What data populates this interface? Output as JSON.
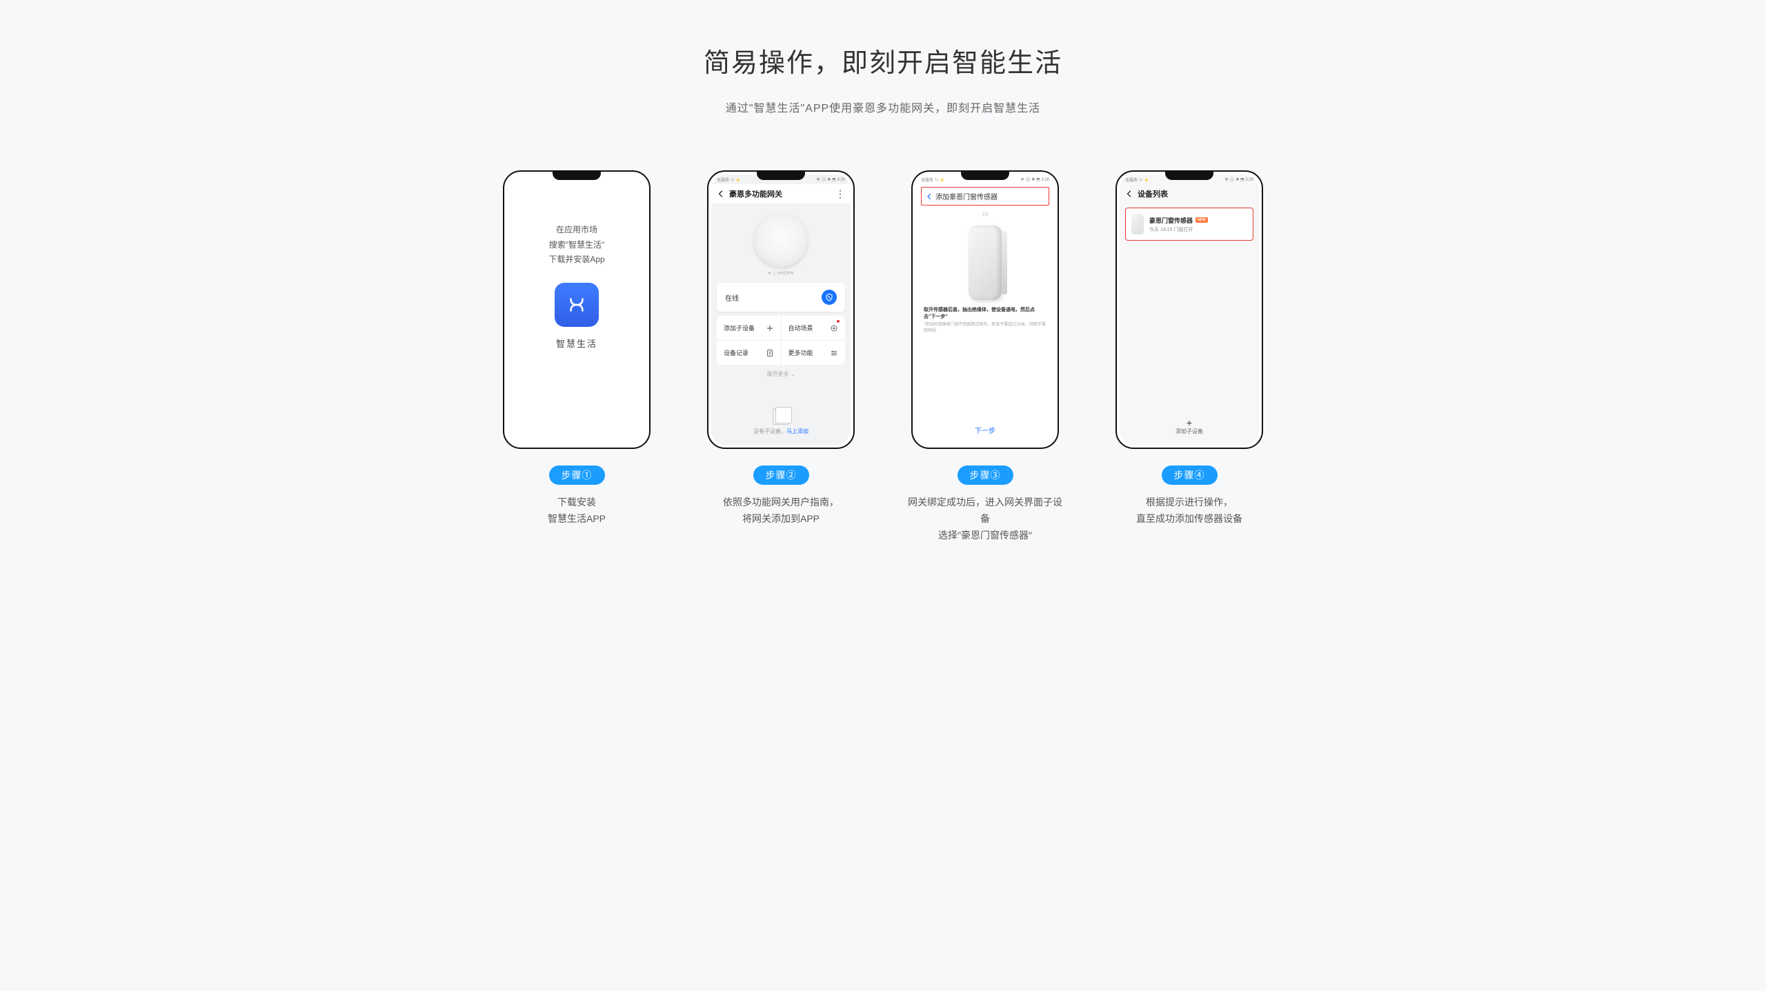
{
  "headline": "简易操作，即刻开启智能生活",
  "subhead": "通过\"智慧生活\"APP使用豪恩多功能网关，即刻开启智慧生活",
  "statusbar": {
    "left": "无服务 ⇋ ⚡",
    "right": "❋ ⚪ ✱ ⬒ 3:28"
  },
  "phone1": {
    "line1": "在应用市场",
    "line2": "搜索\"智慧生活\"",
    "line3": "下载并安装App",
    "app_label": "智慧生活"
  },
  "phone2": {
    "nav_title": "豪恩多功能网关",
    "brand": "iHORN",
    "status_label": "在线",
    "cells": {
      "add_sub": "添加子设备",
      "auto_scene": "自动场景",
      "device_log": "设备记录",
      "more": "更多功能"
    },
    "expand": "展开更多 ⌄",
    "foot_text": "没有子设备，",
    "foot_link": "马上添加"
  },
  "phone3": {
    "add_title": "添加豪恩门窗传感器",
    "counter": "1/2",
    "desc": "取开传感器后盖，抽出绝缘体，使设备通电，然后点击\"下一步\"",
    "note": "*添加时请确保门窗传感器靠近网关，距离不要超过30米，网络不要跨网段",
    "next": "下一步"
  },
  "phone4": {
    "nav_title": "设备列表",
    "item_title": "豪恩门窗传感器",
    "item_badge": "NEW",
    "item_sub": "今天 14:15 门窗打开",
    "add_label": "添加子设备"
  },
  "steps": [
    {
      "badge": "步骤①",
      "desc1": "下载安装",
      "desc2": "智慧生活APP"
    },
    {
      "badge": "步骤②",
      "desc1": "依照多功能网关用户指南，",
      "desc2": "将网关添加到APP"
    },
    {
      "badge": "步骤③",
      "desc1": "网关绑定成功后，进入网关界面子设备",
      "desc2": "选择\"豪恩门窗传感器\""
    },
    {
      "badge": "步骤④",
      "desc1": "根据提示进行操作，",
      "desc2": "直至成功添加传感器设备"
    }
  ]
}
